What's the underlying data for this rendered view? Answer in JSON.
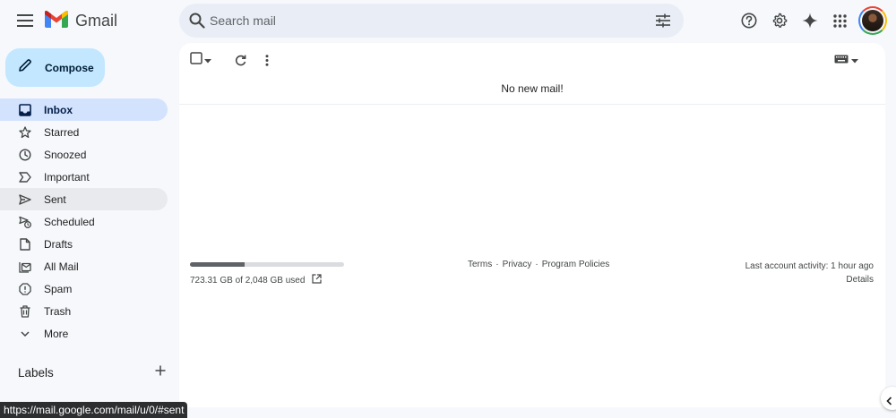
{
  "app": {
    "name": "Gmail"
  },
  "search": {
    "placeholder": "Search mail"
  },
  "header": {
    "icons": [
      "menu-icon",
      "search-icon",
      "filter-icon",
      "help-icon",
      "settings-icon",
      "gemini-icon",
      "apps-icon"
    ]
  },
  "compose": {
    "label": "Compose"
  },
  "sidebar": {
    "items": [
      {
        "label": "Inbox",
        "icon": "inbox-icon",
        "state": "active"
      },
      {
        "label": "Starred",
        "icon": "star-icon"
      },
      {
        "label": "Snoozed",
        "icon": "clock-icon"
      },
      {
        "label": "Important",
        "icon": "important-icon"
      },
      {
        "label": "Sent",
        "icon": "send-icon",
        "state": "hover"
      },
      {
        "label": "Scheduled",
        "icon": "schedule-send-icon"
      },
      {
        "label": "Drafts",
        "icon": "draft-icon"
      },
      {
        "label": "All Mail",
        "icon": "all-mail-icon"
      },
      {
        "label": "Spam",
        "icon": "spam-icon"
      },
      {
        "label": "Trash",
        "icon": "trash-icon"
      },
      {
        "label": "More",
        "icon": "chevron-down-icon"
      }
    ],
    "labels_title": "Labels"
  },
  "main": {
    "empty_message": "No new mail!",
    "storage": {
      "text": "723.31 GB of 2,048 GB used",
      "used_fraction": 0.353
    },
    "footer_links": [
      "Terms",
      "·",
      "Privacy",
      "·",
      "Program Policies"
    ],
    "activity": "Last account activity: 1 hour ago",
    "details": "Details"
  },
  "status_bar": {
    "url": "https://mail.google.com/mail/u/0/#sent"
  },
  "colors": {
    "background": "#f6f8fc",
    "active_nav": "#d3e3fd",
    "compose": "#c2e7ff",
    "search_bg": "#e9eef6"
  }
}
